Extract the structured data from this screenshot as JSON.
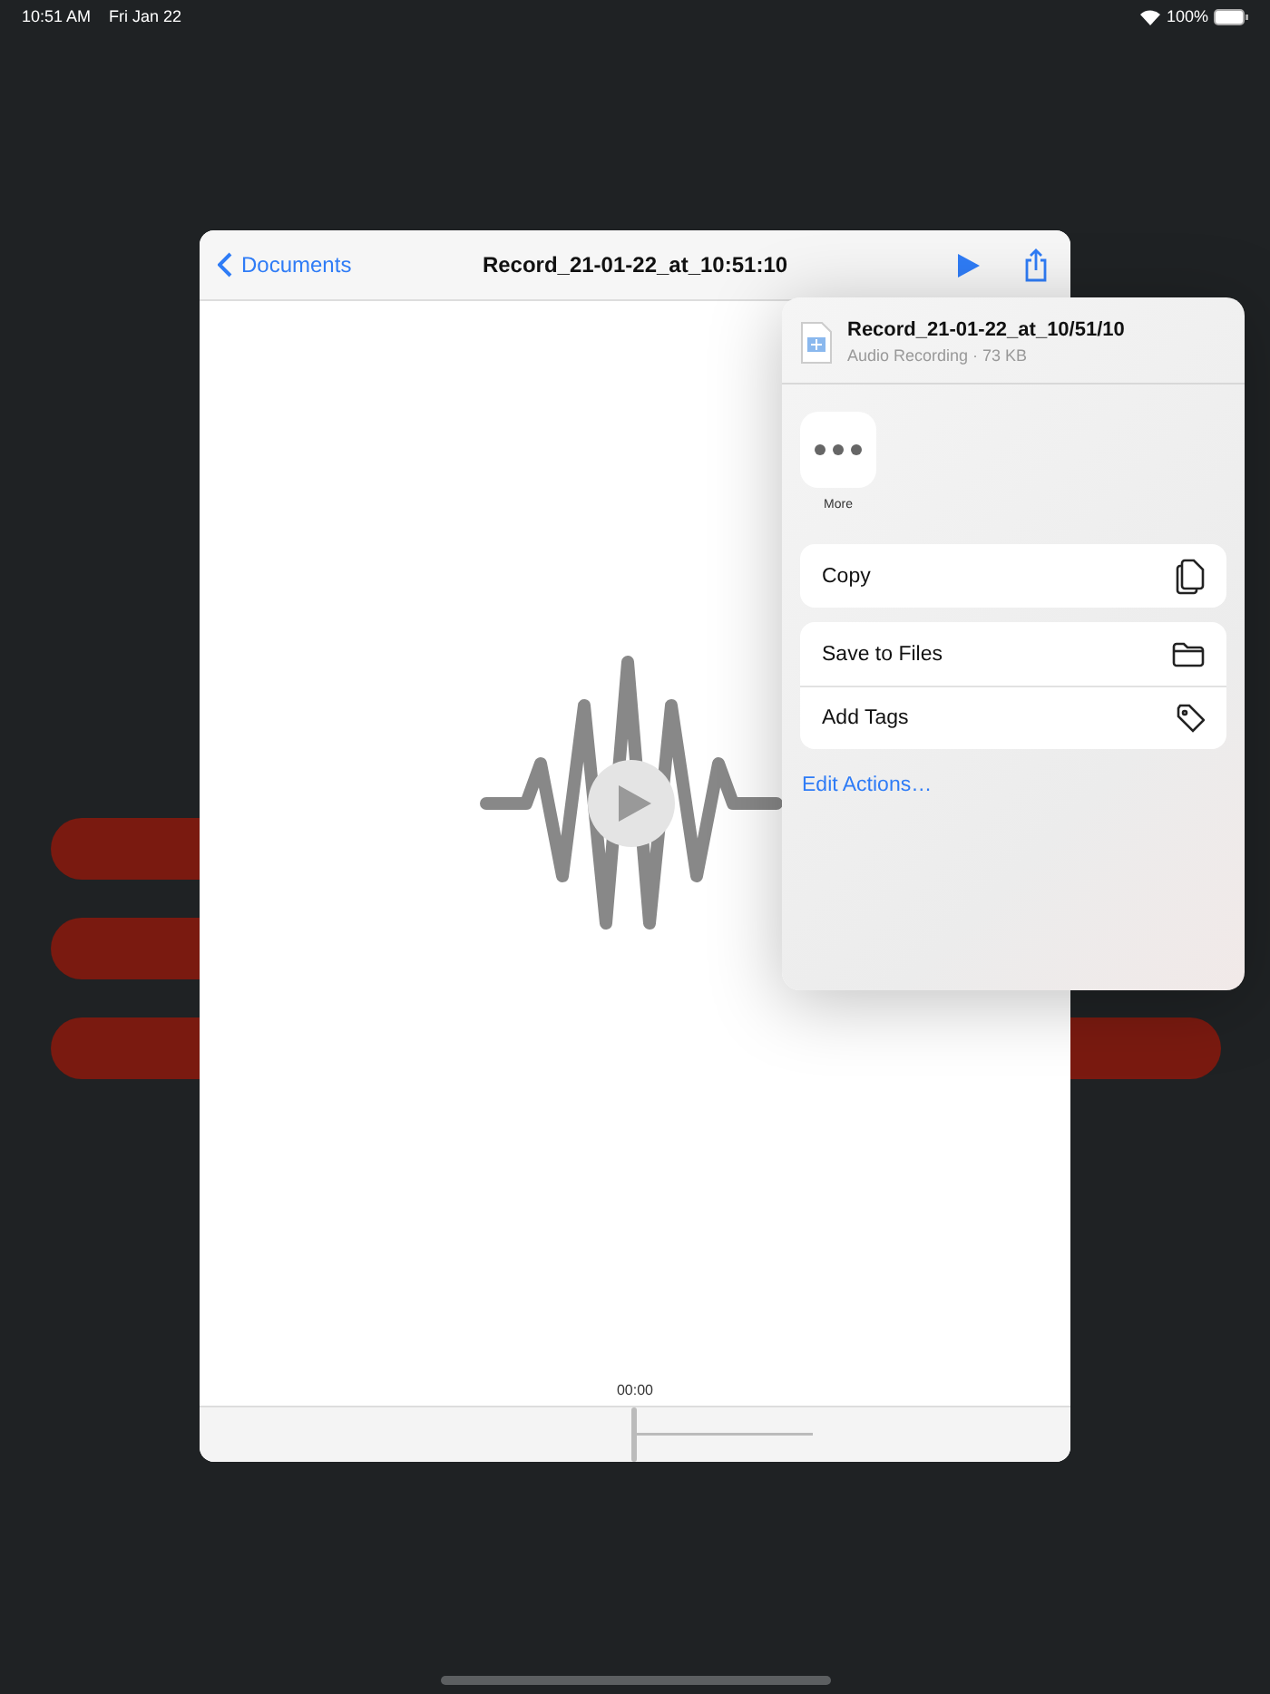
{
  "status_bar": {
    "time": "10:51 AM",
    "date": "Fri Jan 22",
    "battery": "100%"
  },
  "window": {
    "back_label": "Documents",
    "title": "Record_21-01-22_at_10:51:10"
  },
  "player": {
    "time": "00:00"
  },
  "share_sheet": {
    "file_name": "Record_21-01-22_at_10/51/10",
    "file_info": "Audio Recording · 73 KB",
    "apps": [
      {
        "label": "More",
        "kind": "more"
      }
    ],
    "action_groups": [
      [
        {
          "label": "Copy",
          "kind": "copy"
        }
      ],
      [
        {
          "label": "Save to Files",
          "kind": "save"
        },
        {
          "label": "Add Tags",
          "kind": "tags"
        }
      ]
    ],
    "edit_link": "Edit Actions…"
  }
}
